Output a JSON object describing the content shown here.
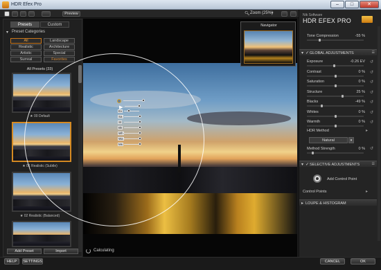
{
  "window": {
    "title": "HDR Efex Pro",
    "min": "–",
    "max": "□",
    "close": "✕"
  },
  "toolbar": {
    "preview": "Preview",
    "zoom": "Zoom (25%)"
  },
  "left": {
    "tabs": [
      "Presets",
      "Custom"
    ],
    "categories_header": "Preset Categories",
    "categories": [
      "All",
      "Landscape",
      "Realistic",
      "Architecture",
      "Artistic",
      "Special",
      "Surreal",
      "Favorites"
    ],
    "all_presets": "All Presets (33)",
    "presets": [
      {
        "label": "★ 00 Default"
      },
      {
        "label": "★ 01 Realistic (Subtle)"
      },
      {
        "label": "★ 02 Realistic (Balanced)"
      }
    ],
    "add_preset": "Add Preset",
    "import": "Import"
  },
  "canvas": {
    "calculating": "Calculating",
    "control_point_labels": [
      "Ex",
      "Sa",
      "St",
      "Bk",
      "Wh",
      "Wa",
      "Ms"
    ],
    "control_point_sizes": [
      "+",
      "-"
    ]
  },
  "navigator": {
    "title": "Navigator"
  },
  "right": {
    "brand_small": "Nik Software",
    "brand": "HDR EFEX PRO",
    "tone_compression": {
      "label": "Tone Compression",
      "value": "-55 %",
      "level": 0.22
    },
    "global_title": "GLOBAL ADJUSTMENTS",
    "global": [
      {
        "label": "Exposure",
        "value": "-0.26  EV",
        "level": 0.48
      },
      {
        "label": "Contrast",
        "value": "0 %",
        "level": 0.5
      },
      {
        "label": "Saturation",
        "value": "0 %",
        "level": 0.5
      },
      {
        "label": "Structure",
        "value": "25 %",
        "level": 0.62
      },
      {
        "label": "Blacks",
        "value": "-49 %",
        "level": 0.25
      },
      {
        "label": "Whites",
        "value": "0 %",
        "level": 0.5
      },
      {
        "label": "Warmth",
        "value": "0 %",
        "level": 0.5
      }
    ],
    "hdr_method": "HDR Method",
    "method_value": "Natural",
    "method_strength": {
      "label": "Method Strength",
      "value": "0 %",
      "level": 0.1
    },
    "selective_title": "SELECTIVE ADJUSTMENTS",
    "add_cp": "Add Control Point",
    "control_points": "Control Points",
    "loupe_title": "LOUPE & HISTOGRAM"
  },
  "bottom": {
    "help": "HELP",
    "settings": "SETTINGS",
    "cancel": "CANCEL",
    "ok": "OK"
  }
}
